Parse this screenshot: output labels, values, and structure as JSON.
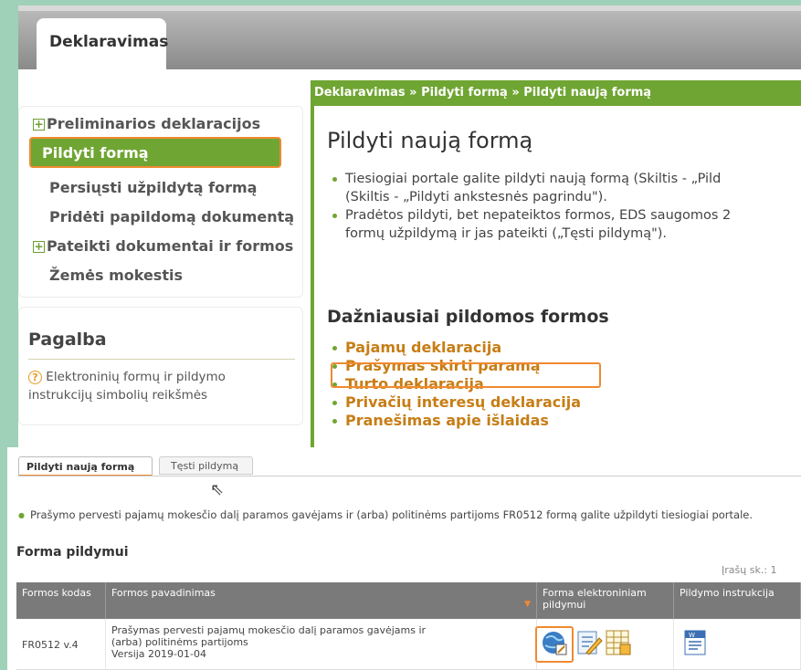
{
  "top": {
    "tab_label": "Deklaravimas",
    "nav": {
      "items": [
        {
          "label": "Preliminarios deklaracijos",
          "expandable": true
        },
        {
          "label": "Pildyti formą",
          "active": true
        },
        {
          "label": "Persiųsti užpildytą formą"
        },
        {
          "label": "Pridėti papildomą dokumentą"
        },
        {
          "label": "Pateikti dokumentai ir formos",
          "expandable": true
        },
        {
          "label": "Žemės mokestis"
        }
      ]
    },
    "help": {
      "title": "Pagalba",
      "text": "Elektroninių formų ir pildymo instrukcijų simbolių reikšmės"
    },
    "breadcrumb": "Deklaravimas » Pildyti formą » Pildyti naują formą",
    "main": {
      "title": "Pildyti naują formą",
      "bullet1_line1": "Tiesiogiai portale galite pildyti naują formą (Skiltis - „Pild",
      "bullet1_line2": "(Skiltis - „Pildyti ankstesnės pagrindu\").",
      "bullet2_line1": "Pradėtos pildyti, bet nepateiktos formos, EDS saugomos 2",
      "bullet2_line2": "formų užpildymą ir jas pateikti („Tęsti pildymą\").",
      "frequent_title": "Dažniausiai pildomos formos",
      "frequent": [
        "Pajamų deklaracija",
        "Prašymas skirti paramą",
        "Turto deklaracija",
        "Privačių interesų deklaracija",
        "Pranešimas apie išlaidas"
      ]
    }
  },
  "bottom": {
    "tabs": [
      "Pildyti naują formą",
      "Tęsti pildymą"
    ],
    "info": "Prašymo pervesti pajamų mokesčio dalį paramos gavėjams ir (arba) politinėms partijoms FR0512 formą galite užpildyti tiesiogiai portale.",
    "section_title": "Forma pildymui",
    "count_label": "Įrašų sk.: 1",
    "columns": [
      "Formos kodas",
      "Formos pavadinimas",
      "Forma elektroniniam pildymui",
      "Pildymo instrukcija"
    ],
    "row": {
      "code": "FR0512 v.4",
      "name": "Prašymas pervesti pajamų mokesčio dalį paramos gavėjams ir (arba) politinėms partijoms",
      "version": "Versija 2019-01-04"
    },
    "icons": [
      "globe-edit-icon",
      "form-edit-icon",
      "spreadsheet-icon",
      "word-document-icon"
    ],
    "colors": {
      "accent": "#6fa532",
      "highlight": "#f08a30",
      "header": "#7a7a7a"
    }
  }
}
